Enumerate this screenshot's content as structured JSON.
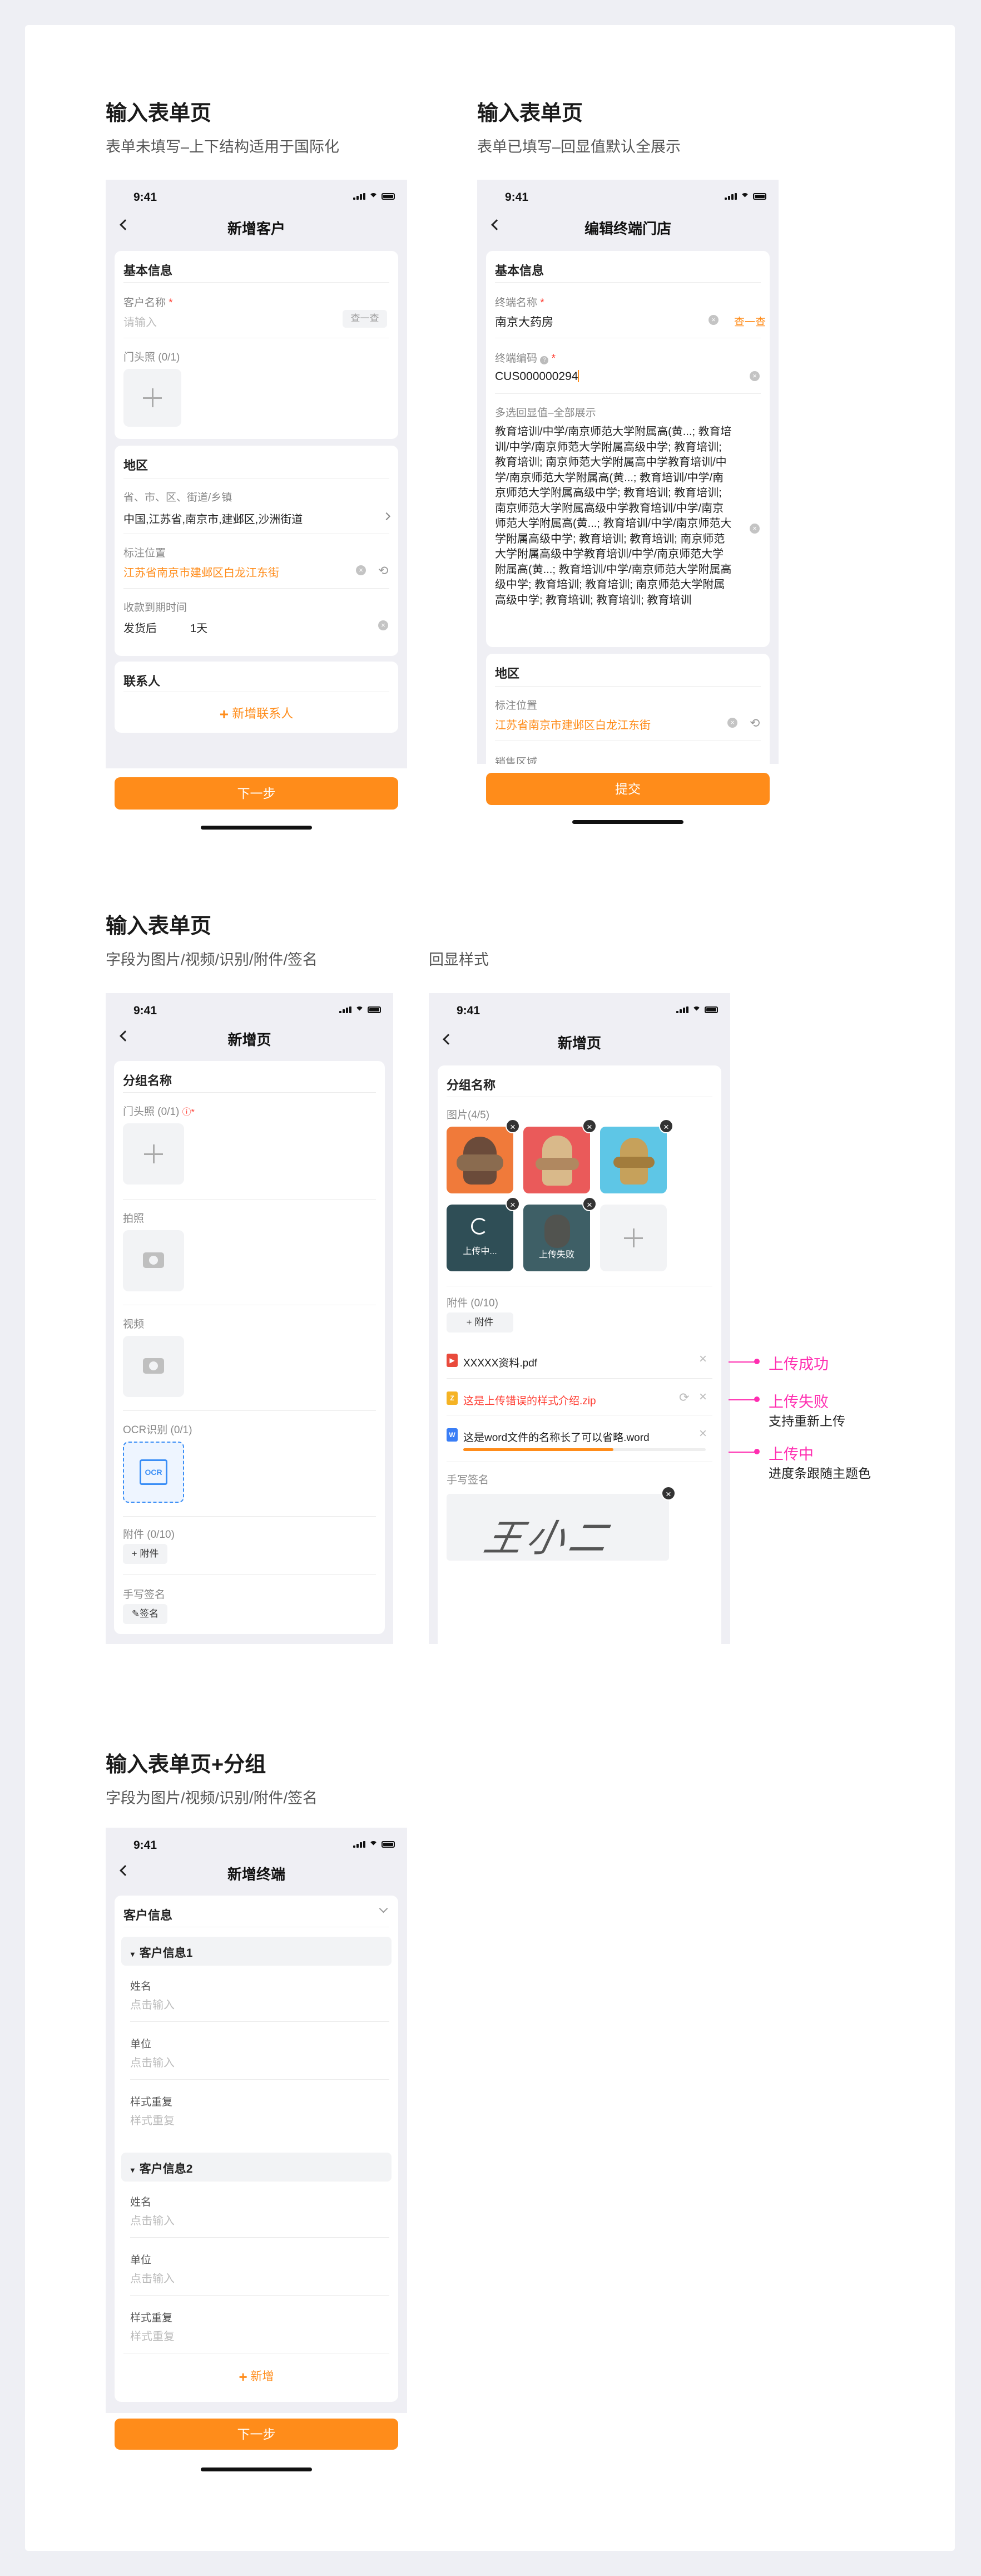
{
  "sections": {
    "s1": {
      "title": "输入表单页",
      "subtitle": "表单未填写–上下结构适用于国际化"
    },
    "s2": {
      "title": "输入表单页",
      "subtitle": "表单已填写–回显值默认全展示"
    },
    "s3": {
      "title": "输入表单页",
      "subtitle": "字段为图片/视频/识别/附件/签名",
      "echo_label": "回显样式"
    },
    "s4": {
      "title": "输入表单页+分组",
      "subtitle": "字段为图片/视频/识别/附件/签名"
    }
  },
  "status_time": "9:41",
  "phone1": {
    "nav_title": "新增客户",
    "basic": {
      "title": "基本信息",
      "name_label": "客户名称",
      "name_placeholder": "请输入",
      "lookup_btn": "查一查",
      "photo_label": "门头照 (0/1)"
    },
    "region": {
      "title": "地区",
      "area_label": "省、市、区、街道/乡镇",
      "area_value": "中国,江苏省,南京市,建邺区,沙洲街道",
      "mark_label": "标注位置",
      "mark_value": "江苏省南京市建邺区白龙江东街",
      "due_label": "收款到期时间",
      "due_prefix": "发货后",
      "due_value": "1天"
    },
    "contact": {
      "title": "联系人",
      "add_label": "新增联系人"
    },
    "next_btn": "下一步"
  },
  "phone2": {
    "nav_title": "编辑终端门店",
    "basic": {
      "title": "基本信息",
      "name_label": "终端名称",
      "name_value": "南京大药房",
      "lookup_btn": "查一查",
      "code_label": "终端编码",
      "code_value": "CUS000000294",
      "multi_label": "多选回显值–全部展示",
      "multi_value": "教育培训/中学/南京师范大学附属高(黄...; 教育培训/中学/南京师范大学附属高级中学; 教育培训; 教育培训; 南京师范大学附属高中学教育培训/中学/南京师范大学附属高(黄...; 教育培训/中学/南京师范大学附属高级中学; 教育培训; 教育培训; 南京师范大学附属高级中学教育培训/中学/南京师范大学附属高(黄...; 教育培训/中学/南京师范大学附属高级中学; 教育培训; 教育培训; 南京师范大学附属高级中学教育培训/中学/南京师范大学附属高(黄...; 教育培训/中学/南京师范大学附属高级中学; 教育培训; 教育培训; 南京师范大学附属高级中学; 教育培训; 教育培训; 教育培训"
    },
    "region": {
      "title": "地区",
      "mark_label": "标注位置",
      "mark_value": "江苏省南京市建邺区白龙江东街",
      "sales_label": "销售区域"
    },
    "submit_btn": "提交"
  },
  "phone3": {
    "nav_title": "新增页",
    "group": "分组名称",
    "photo_label": "门头照 (0/1)",
    "shoot_label": "拍照",
    "video_label": "视频",
    "ocr_label": "OCR识别 (0/1)",
    "ocr_icon_text": "OCR",
    "attach_label": "附件 (0/10)",
    "attach_btn": "附件",
    "sign_label": "手写签名",
    "sign_btn": "签名"
  },
  "phone4": {
    "nav_title": "新增页",
    "group": "分组名称",
    "images_label": "图片(4/5)",
    "uploading": "上传中...",
    "upload_failed": "上传失败",
    "attach_label": "附件 (0/10)",
    "attach_btn": "附件",
    "files": [
      {
        "name": "XXXXX资料.pdf",
        "icon": "pdf-icon",
        "type": "pdf"
      },
      {
        "name": "这是上传错误的样式介绍.zip",
        "icon": "zip-icon",
        "type": "zip"
      },
      {
        "name": "这是word文件的名称长了可以省略.word",
        "icon": "word-icon",
        "type": "word",
        "progress": 0.62
      }
    ],
    "sign_label": "手写签名",
    "signature_text": "王小二"
  },
  "annotations": {
    "success": "上传成功",
    "failed": "上传失败",
    "failed_sub": "支持重新上传",
    "uploading": "上传中",
    "uploading_sub": "进度条跟随主题色"
  },
  "phone5": {
    "nav_title": "新增终端",
    "customer_info": "客户信息",
    "groups": [
      {
        "title": "客户信息1",
        "fields": [
          {
            "label": "姓名",
            "placeholder": "点击输入"
          },
          {
            "label": "单位",
            "placeholder": "点击输入"
          },
          {
            "label": "样式重复",
            "placeholder": "样式重复"
          }
        ]
      },
      {
        "title": "客户信息2",
        "fields": [
          {
            "label": "姓名",
            "placeholder": "点击输入"
          },
          {
            "label": "单位",
            "placeholder": "点击输入"
          },
          {
            "label": "样式重复",
            "placeholder": "样式重复"
          }
        ]
      }
    ],
    "add_label": "新增",
    "next_btn": "下一步"
  },
  "colors": {
    "primary": "#ff8c1a",
    "annotation": "#ff2db0",
    "error": "#ff3b30"
  }
}
